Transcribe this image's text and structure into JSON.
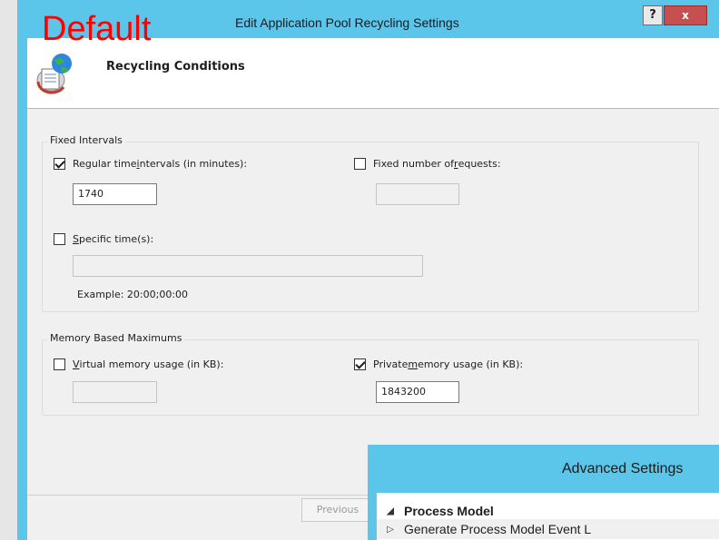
{
  "annotation": "Default",
  "dialog": {
    "title": "Edit Application Pool Recycling Settings",
    "help_label": "?",
    "close_label": "x",
    "header": "Recycling Conditions"
  },
  "fixed_intervals": {
    "group_label": "Fixed Intervals",
    "regular_label_pre": "Regular time ",
    "regular_label_u": "i",
    "regular_label_post": "ntervals (in minutes):",
    "regular_checked": true,
    "regular_value": "1740",
    "requests_label_pre": "Fixed number of ",
    "requests_label_u": "r",
    "requests_label_post": "equests:",
    "requests_checked": false,
    "requests_value": "",
    "specific_label_u": "S",
    "specific_label_post": "pecific time(s):",
    "specific_checked": false,
    "specific_value": "",
    "example": "Example: 20:00;00:00"
  },
  "memory": {
    "group_label": "Memory Based Maximums",
    "virtual_label_u": "V",
    "virtual_label_post": "irtual memory usage (in KB):",
    "virtual_checked": false,
    "virtual_value": "",
    "private_label_pre": "Private ",
    "private_label_u": "m",
    "private_label_post": "emory usage (in KB):",
    "private_checked": true,
    "private_value": "1843200"
  },
  "footer": {
    "previous_label": "Previous"
  },
  "advanced": {
    "title": "Advanced Settings",
    "category": "Process Model",
    "item": "Generate Process Model Event L"
  },
  "colors": {
    "accent": "#5bc6ea",
    "close": "#c74f50",
    "annotation": "#ff0000"
  }
}
